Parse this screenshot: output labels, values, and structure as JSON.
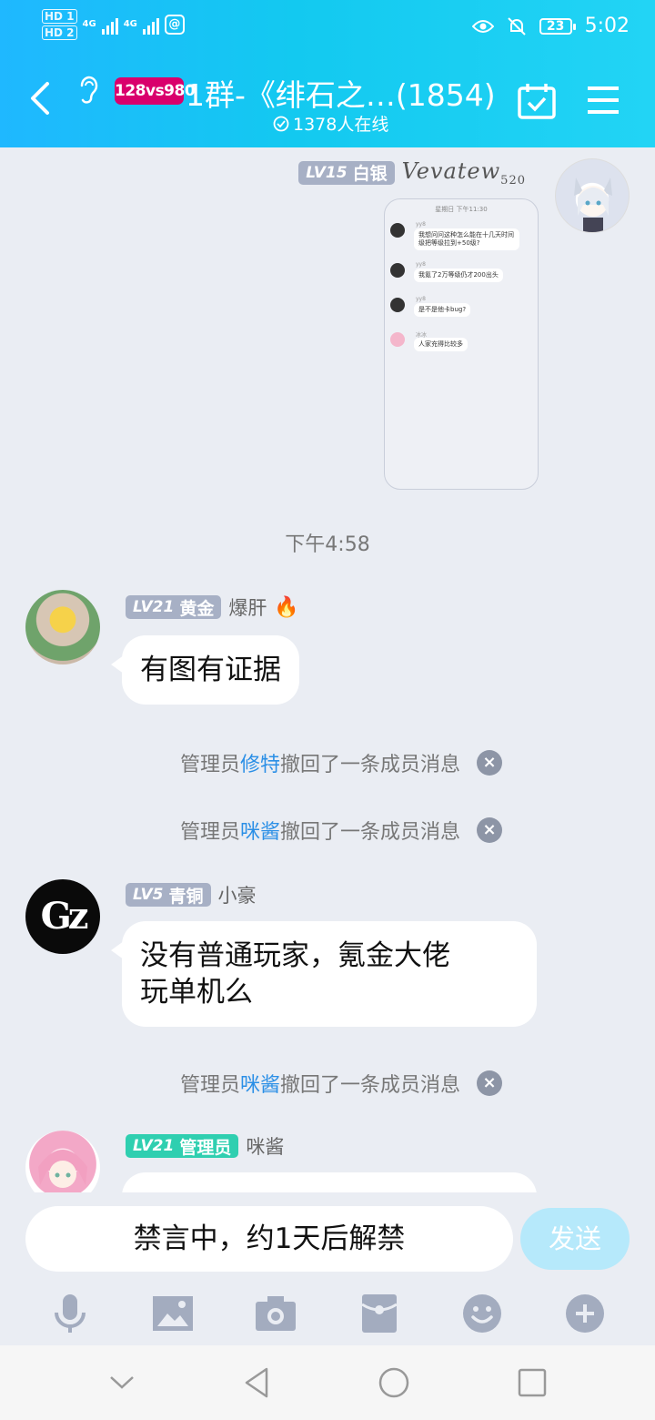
{
  "status_bar": {
    "hd1": "HD 1",
    "hd2": "HD 2",
    "net1": "4G",
    "net2": "4G",
    "battery": "23",
    "time": "5:02"
  },
  "header": {
    "brand": "128vs980",
    "title": "1群-《绯石之…(1854)",
    "online": "1378人在线"
  },
  "messages": {
    "m1": {
      "level": "LV15",
      "rank": "白银",
      "signature": "Vevatew",
      "signature_num": "520"
    },
    "shot": {
      "head": "星期日 下午11:30",
      "items": [
        {
          "name": "yy8",
          "text": "我想问问这种怎么能在十几天时间级把等级拉到+50级?"
        },
        {
          "name": "yy8",
          "text": "我氪了2万等级仍才200出头"
        },
        {
          "name": "yy8",
          "text": "是不是他卡bug?"
        },
        {
          "name": "冰冰",
          "text": "人家充得比较多"
        }
      ]
    },
    "time_label": "下午4:58",
    "m2": {
      "level": "LV21",
      "rank": "黄金",
      "nick": "爆肝",
      "flame": "🔥",
      "text": "有图有证据"
    },
    "n1": {
      "prefix": "管理员",
      "who": "修特",
      "suffix": "撤回了一条成员消息"
    },
    "n2": {
      "prefix": "管理员",
      "who": "咪酱",
      "suffix": "撤回了一条成员消息"
    },
    "m3": {
      "level": "LV5",
      "rank": "青铜",
      "nick": "小豪",
      "avatar_text": "Gz",
      "line1": "没有普通玩家，氪金大佬",
      "line2": "玩单机么"
    },
    "n3": {
      "prefix": "管理员",
      "who": "咪酱",
      "suffix": "撤回了一条成员消息"
    },
    "m4": {
      "level": "LV21",
      "rank": "管理员",
      "nick": "咪酱"
    }
  },
  "input": {
    "muted_text": "禁言中，约1天后解禁",
    "send_label": "发送"
  },
  "toolbar_icons": [
    "microphone-icon",
    "image-icon",
    "camera-icon",
    "red-packet-icon",
    "emoji-icon",
    "plus-icon"
  ],
  "colors": {
    "header_start": "#1fb8ff",
    "header_end": "#22d4f5",
    "link": "#2b8fe6",
    "admin_badge": "#2fcfb0",
    "badge": "#a7b0c5"
  }
}
